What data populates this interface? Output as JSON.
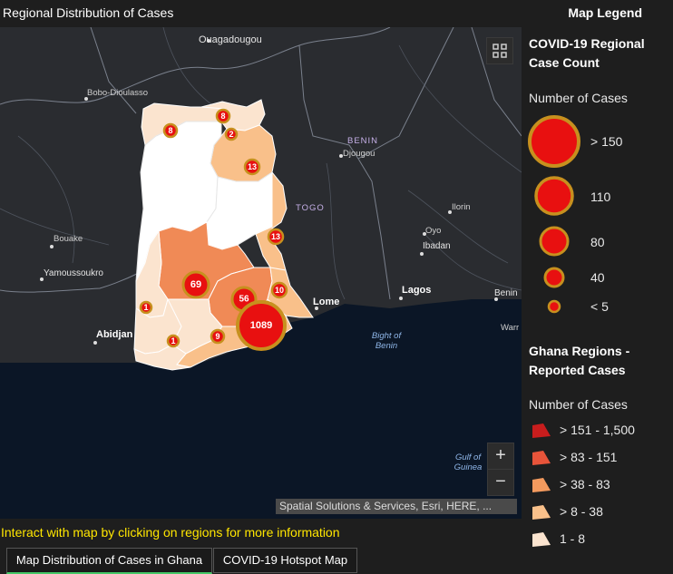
{
  "header": {
    "title": "Regional Distribution of Cases"
  },
  "legend": {
    "heading": "Map Legend",
    "section1_title": "COVID-19 Regional Case Count",
    "section1_sub": "Number of Cases",
    "circles": [
      {
        "label": "> 150"
      },
      {
        "label": "110"
      },
      {
        "label": "80"
      },
      {
        "label": "40"
      },
      {
        "label": "< 5"
      }
    ],
    "section2_title": "Ghana Regions - Reported Cases",
    "section2_sub": "Number of Cases",
    "classes": [
      {
        "label": "> 151 - 1,500",
        "color": "#c81d1d"
      },
      {
        "label": "> 83 - 151",
        "color": "#e8543a"
      },
      {
        "label": "> 38 - 83",
        "color": "#f39a5e"
      },
      {
        "label": "> 8 - 38",
        "color": "#f9c08a"
      },
      {
        "label": "1 - 8",
        "color": "#fbe4cf"
      }
    ]
  },
  "map": {
    "places": {
      "ouagadougou": "Ouagadougou",
      "bobo": "Bobo-Dioulasso",
      "benin": "BENIN",
      "djougou": "Djougou",
      "togo": "TOGO",
      "ilorin": "Ilorin",
      "oyo": "Oyo",
      "ibadan": "Ibadan",
      "bouake": "Bouake",
      "yamoussoukro": "Yamoussoukro",
      "lome": "Lome",
      "lagos": "Lagos",
      "benin_city": "Benin",
      "warri": "Warr",
      "abidjan": "Abidjan",
      "bight": "Bight of Benin",
      "gulf": "Gulf of Guinea"
    },
    "markers": [
      {
        "value": "8"
      },
      {
        "value": "8"
      },
      {
        "value": "2"
      },
      {
        "value": "13"
      },
      {
        "value": "13"
      },
      {
        "value": "69"
      },
      {
        "value": "56"
      },
      {
        "value": "10"
      },
      {
        "value": "1"
      },
      {
        "value": "1"
      },
      {
        "value": "9"
      },
      {
        "value": "1089"
      }
    ],
    "zoom_in": "+",
    "zoom_out": "−",
    "attribution": "Spatial Solutions & Services, Esri, HERE, ..."
  },
  "hint": "Interact with map by clicking on regions for more information",
  "tabs": [
    {
      "label": "Map Distribution of Cases in Ghana"
    },
    {
      "label": "COVID-19 Hotspot Map"
    }
  ]
}
